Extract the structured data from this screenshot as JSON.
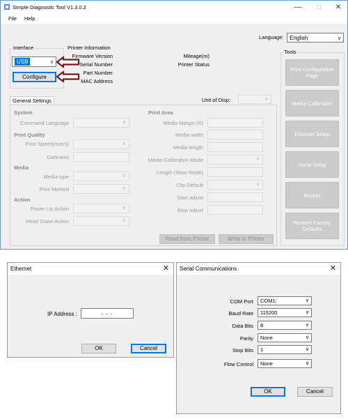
{
  "app": {
    "title": "Simple Diagnostic Tool V1.3.0.2",
    "window_controls": {
      "minimize": "—",
      "maximize": "□",
      "close": "✕"
    },
    "menu": [
      "File",
      "Help"
    ]
  },
  "language": {
    "label": "Language:",
    "value": "English"
  },
  "interface": {
    "title": "Interface",
    "selected": "USB",
    "configure_label": "Configure"
  },
  "printer_info": {
    "title": "Printer Information",
    "left_labels": [
      "Firmware Version",
      "Serial Number",
      "Part Number",
      "MAC Address"
    ],
    "right_labels": [
      "Mileage(m)",
      "Printer Status"
    ]
  },
  "tools": {
    "title": "Tools",
    "buttons": [
      "Print Configuration Page",
      "Media Calibration",
      "Ethernet Setup",
      "Serial Setup",
      "Restart",
      "Restore Factory Defaults"
    ]
  },
  "settings": {
    "tab_label": "General Settings",
    "unit_label": "Unit of Disp:",
    "system_header": "System",
    "command_language": "Command Language",
    "print_quality_header": "Print Quality",
    "print_speed": "Print Speed(mm/s)",
    "darkness": "Darkness",
    "media_header": "Media",
    "media_type": "Media type",
    "print_method": "Print Method",
    "action_header": "Action",
    "power_up_action": "Power Up Action",
    "head_down_action": "Head Down Action",
    "print_area_header": "Print Area",
    "right_labels": [
      "Media Margin (X)",
      "Media width",
      "Media length",
      "Media Calibration Mode",
      "Length (Slow Mode)",
      "Clip Default",
      "Start adjust",
      "Stop adjust"
    ],
    "read_button": "Read from Printer",
    "write_button": "Write to Printer"
  },
  "ethernet_dialog": {
    "title": "Ethernet",
    "close_icon": "✕",
    "ip_label": "IP Address :",
    "ip_placeholder": ".     .     .",
    "ok_label": "OK",
    "cancel_label": "Cancel"
  },
  "serial_dialog": {
    "title": "Serial Communications",
    "close_icon": "✕",
    "rows": [
      {
        "label": "COM Port",
        "value": "COM1:"
      },
      {
        "label": "Baud Rate",
        "value": "115200"
      },
      {
        "label": "Data Bits",
        "value": "8"
      },
      {
        "label": "Parity",
        "value": "None"
      },
      {
        "label": "Stop Bits",
        "value": "1"
      },
      {
        "label": "Flow Control",
        "value": "None"
      }
    ],
    "ok_label": "OK",
    "cancel_label": "Cancel"
  },
  "colors": {
    "accent": "#0078d7",
    "arrow": "#7b1520",
    "window_border": "#6e93c6",
    "disabled_button": "#cccccc"
  }
}
